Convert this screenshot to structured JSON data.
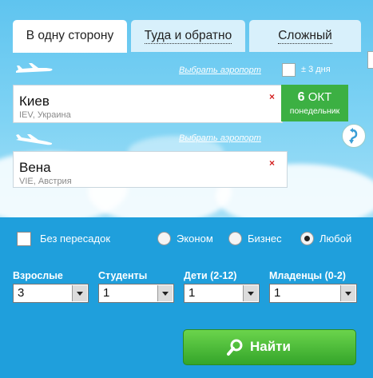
{
  "tabs": [
    {
      "label": "В одну сторону"
    },
    {
      "label": "Туда и обратно"
    },
    {
      "label": "Сложный"
    }
  ],
  "departure": {
    "choose_airport_link": "Выбрать аэропорт",
    "city": "Киев",
    "airport": "IEV, Украина",
    "clear": "×"
  },
  "date": {
    "day": "6",
    "month": "ОКТ",
    "weekday": "понедельник"
  },
  "flex_dates": {
    "label": "± 3 дня",
    "checked": false
  },
  "arrival": {
    "choose_airport_link": "Выбрать аэропорт",
    "city": "Вена",
    "airport": "VIE, Австрия",
    "clear": "×"
  },
  "options": {
    "direct_label": "Без пересадок",
    "classes": [
      {
        "label": "Эконом",
        "selected": false
      },
      {
        "label": "Бизнес",
        "selected": false
      },
      {
        "label": "Любой",
        "selected": true
      }
    ]
  },
  "passengers": [
    {
      "label": "Взрослые",
      "value": "3"
    },
    {
      "label": "Студенты",
      "value": "1"
    },
    {
      "label": "Дети (2-12)",
      "value": "1"
    },
    {
      "label": "Младенцы (0-2)",
      "value": "1"
    }
  ],
  "search_button": {
    "label": "Найти"
  },
  "colors": {
    "sky": "#7fd3f4",
    "panel": "#1f9fdc",
    "date_green": "#3cb043",
    "clear_red": "#d42020"
  }
}
